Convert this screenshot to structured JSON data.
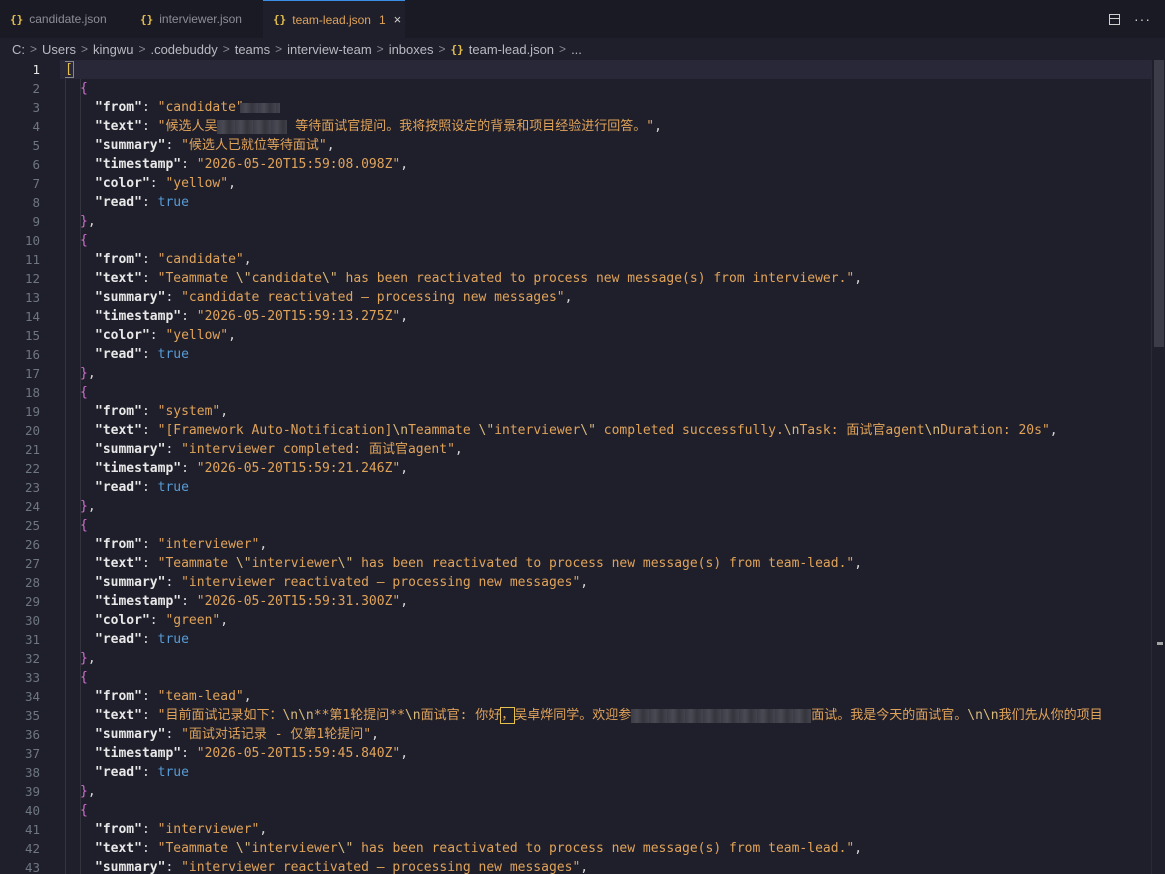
{
  "tabs": [
    {
      "label": "candidate.json",
      "icon": "json-braces-icon",
      "active": false
    },
    {
      "label": "interviewer.json",
      "icon": "json-braces-icon",
      "active": false
    },
    {
      "label": "team-lead.json",
      "icon": "json-braces-icon",
      "active": true,
      "problems_count": "1"
    }
  ],
  "tab_icon_glyph": "{}",
  "tab_close_glyph": "×",
  "actions": {
    "split_editor_icon": "split-editor-icon",
    "more_icon": "more-actions-icon",
    "more_glyph": "···"
  },
  "breadcrumb": [
    "C:",
    "Users",
    "kingwu",
    ".codebuddy",
    "teams",
    "interview-team",
    "inboxes",
    "team-lead.json",
    "..."
  ],
  "breadcrumb_separator": ">",
  "editor": {
    "active_line": 1,
    "line_numbers": [
      "1",
      "2",
      "3",
      "4",
      "5",
      "6",
      "7",
      "8",
      "9",
      "10",
      "11",
      "12",
      "13",
      "14",
      "15",
      "16",
      "17",
      "18",
      "19",
      "20",
      "21",
      "22",
      "23",
      "24",
      "25",
      "26",
      "27",
      "28",
      "29",
      "30",
      "31",
      "32",
      "33",
      "34",
      "35",
      "36",
      "37",
      "38",
      "39",
      "40",
      "41",
      "42",
      "43"
    ],
    "colors": {
      "background": "#1f1f2b",
      "key": "#e8e8e8",
      "string": "#e0a35a",
      "boolean": "#569cd6",
      "bracket_outer": "#e5c04d",
      "bracket_inner": "#d070d0"
    },
    "code_lines": [
      {
        "indent": 0,
        "tokens": [
          {
            "t": "b0",
            "v": "["
          }
        ],
        "bracket_box": true
      },
      {
        "indent": 1,
        "tokens": [
          {
            "t": "b1",
            "v": "{"
          }
        ]
      },
      {
        "indent": 2,
        "tokens": [
          {
            "t": "k",
            "v": "\"from\""
          },
          {
            "t": "p",
            "v": ": "
          },
          {
            "t": "s",
            "v": "\"candidate\""
          }
        ],
        "redact_after": 40
      },
      {
        "indent": 2,
        "tokens": [
          {
            "t": "k",
            "v": "\"text\""
          },
          {
            "t": "p",
            "v": ": "
          },
          {
            "t": "s",
            "v": "\"候选人吴"
          },
          {
            "t": "redact",
            "w": 70
          },
          {
            "t": "s",
            "v": " 等待面试官提问。我将按照设定的背景和项目经验进行回答。\""
          },
          {
            "t": "p",
            "v": ","
          }
        ]
      },
      {
        "indent": 2,
        "tokens": [
          {
            "t": "k",
            "v": "\"summary\""
          },
          {
            "t": "p",
            "v": ": "
          },
          {
            "t": "s",
            "v": "\"候选人已就位等待面试\""
          },
          {
            "t": "p",
            "v": ","
          }
        ]
      },
      {
        "indent": 2,
        "tokens": [
          {
            "t": "k",
            "v": "\"timestamp\""
          },
          {
            "t": "p",
            "v": ": "
          },
          {
            "t": "s",
            "v": "\"2026-05-20T15:59:08.098Z\""
          },
          {
            "t": "p",
            "v": ","
          }
        ]
      },
      {
        "indent": 2,
        "tokens": [
          {
            "t": "k",
            "v": "\"color\""
          },
          {
            "t": "p",
            "v": ": "
          },
          {
            "t": "s",
            "v": "\"yellow\""
          },
          {
            "t": "p",
            "v": ","
          }
        ]
      },
      {
        "indent": 2,
        "tokens": [
          {
            "t": "k",
            "v": "\"read\""
          },
          {
            "t": "p",
            "v": ": "
          },
          {
            "t": "bool",
            "v": "true"
          }
        ]
      },
      {
        "indent": 1,
        "tokens": [
          {
            "t": "b1",
            "v": "}"
          },
          {
            "t": "p",
            "v": ","
          }
        ]
      },
      {
        "indent": 1,
        "tokens": [
          {
            "t": "b1",
            "v": "{"
          }
        ]
      },
      {
        "indent": 2,
        "tokens": [
          {
            "t": "k",
            "v": "\"from\""
          },
          {
            "t": "p",
            "v": ": "
          },
          {
            "t": "s",
            "v": "\"candidate\""
          },
          {
            "t": "p",
            "v": ","
          }
        ]
      },
      {
        "indent": 2,
        "tokens": [
          {
            "t": "k",
            "v": "\"text\""
          },
          {
            "t": "p",
            "v": ": "
          },
          {
            "t": "s",
            "v": "\"Teammate "
          },
          {
            "t": "e",
            "v": "\\\""
          },
          {
            "t": "s",
            "v": "candidate"
          },
          {
            "t": "e",
            "v": "\\\""
          },
          {
            "t": "s",
            "v": " has been reactivated to process new message(s) from interviewer.\""
          },
          {
            "t": "p",
            "v": ","
          }
        ]
      },
      {
        "indent": 2,
        "tokens": [
          {
            "t": "k",
            "v": "\"summary\""
          },
          {
            "t": "p",
            "v": ": "
          },
          {
            "t": "s",
            "v": "\"candidate reactivated — processing new messages\""
          },
          {
            "t": "p",
            "v": ","
          }
        ]
      },
      {
        "indent": 2,
        "tokens": [
          {
            "t": "k",
            "v": "\"timestamp\""
          },
          {
            "t": "p",
            "v": ": "
          },
          {
            "t": "s",
            "v": "\"2026-05-20T15:59:13.275Z\""
          },
          {
            "t": "p",
            "v": ","
          }
        ]
      },
      {
        "indent": 2,
        "tokens": [
          {
            "t": "k",
            "v": "\"color\""
          },
          {
            "t": "p",
            "v": ": "
          },
          {
            "t": "s",
            "v": "\"yellow\""
          },
          {
            "t": "p",
            "v": ","
          }
        ]
      },
      {
        "indent": 2,
        "tokens": [
          {
            "t": "k",
            "v": "\"read\""
          },
          {
            "t": "p",
            "v": ": "
          },
          {
            "t": "bool",
            "v": "true"
          }
        ]
      },
      {
        "indent": 1,
        "tokens": [
          {
            "t": "b1",
            "v": "}"
          },
          {
            "t": "p",
            "v": ","
          }
        ]
      },
      {
        "indent": 1,
        "tokens": [
          {
            "t": "b1",
            "v": "{"
          }
        ]
      },
      {
        "indent": 2,
        "tokens": [
          {
            "t": "k",
            "v": "\"from\""
          },
          {
            "t": "p",
            "v": ": "
          },
          {
            "t": "s",
            "v": "\"system\""
          },
          {
            "t": "p",
            "v": ","
          }
        ]
      },
      {
        "indent": 2,
        "tokens": [
          {
            "t": "k",
            "v": "\"text\""
          },
          {
            "t": "p",
            "v": ": "
          },
          {
            "t": "s",
            "v": "\"[Framework Auto-Notification]"
          },
          {
            "t": "e",
            "v": "\\n"
          },
          {
            "t": "s",
            "v": "Teammate "
          },
          {
            "t": "e",
            "v": "\\\""
          },
          {
            "t": "s",
            "v": "interviewer"
          },
          {
            "t": "e",
            "v": "\\\""
          },
          {
            "t": "s",
            "v": " completed successfully."
          },
          {
            "t": "e",
            "v": "\\n"
          },
          {
            "t": "s",
            "v": "Task: 面试官agent"
          },
          {
            "t": "e",
            "v": "\\n"
          },
          {
            "t": "s",
            "v": "Duration: 20s\""
          },
          {
            "t": "p",
            "v": ","
          }
        ]
      },
      {
        "indent": 2,
        "tokens": [
          {
            "t": "k",
            "v": "\"summary\""
          },
          {
            "t": "p",
            "v": ": "
          },
          {
            "t": "s",
            "v": "\"interviewer completed: 面试官agent\""
          },
          {
            "t": "p",
            "v": ","
          }
        ]
      },
      {
        "indent": 2,
        "tokens": [
          {
            "t": "k",
            "v": "\"timestamp\""
          },
          {
            "t": "p",
            "v": ": "
          },
          {
            "t": "s",
            "v": "\"2026-05-20T15:59:21.246Z\""
          },
          {
            "t": "p",
            "v": ","
          }
        ]
      },
      {
        "indent": 2,
        "tokens": [
          {
            "t": "k",
            "v": "\"read\""
          },
          {
            "t": "p",
            "v": ": "
          },
          {
            "t": "bool",
            "v": "true"
          }
        ]
      },
      {
        "indent": 1,
        "tokens": [
          {
            "t": "b1",
            "v": "}"
          },
          {
            "t": "p",
            "v": ","
          }
        ]
      },
      {
        "indent": 1,
        "tokens": [
          {
            "t": "b1",
            "v": "{"
          }
        ]
      },
      {
        "indent": 2,
        "tokens": [
          {
            "t": "k",
            "v": "\"from\""
          },
          {
            "t": "p",
            "v": ": "
          },
          {
            "t": "s",
            "v": "\"interviewer\""
          },
          {
            "t": "p",
            "v": ","
          }
        ]
      },
      {
        "indent": 2,
        "tokens": [
          {
            "t": "k",
            "v": "\"text\""
          },
          {
            "t": "p",
            "v": ": "
          },
          {
            "t": "s",
            "v": "\"Teammate "
          },
          {
            "t": "e",
            "v": "\\\""
          },
          {
            "t": "s",
            "v": "interviewer"
          },
          {
            "t": "e",
            "v": "\\\""
          },
          {
            "t": "s",
            "v": " has been reactivated to process new message(s) from team-lead.\""
          },
          {
            "t": "p",
            "v": ","
          }
        ]
      },
      {
        "indent": 2,
        "tokens": [
          {
            "t": "k",
            "v": "\"summary\""
          },
          {
            "t": "p",
            "v": ": "
          },
          {
            "t": "s",
            "v": "\"interviewer reactivated — processing new messages\""
          },
          {
            "t": "p",
            "v": ","
          }
        ]
      },
      {
        "indent": 2,
        "tokens": [
          {
            "t": "k",
            "v": "\"timestamp\""
          },
          {
            "t": "p",
            "v": ": "
          },
          {
            "t": "s",
            "v": "\"2026-05-20T15:59:31.300Z\""
          },
          {
            "t": "p",
            "v": ","
          }
        ]
      },
      {
        "indent": 2,
        "tokens": [
          {
            "t": "k",
            "v": "\"color\""
          },
          {
            "t": "p",
            "v": ": "
          },
          {
            "t": "s",
            "v": "\"green\""
          },
          {
            "t": "p",
            "v": ","
          }
        ]
      },
      {
        "indent": 2,
        "tokens": [
          {
            "t": "k",
            "v": "\"read\""
          },
          {
            "t": "p",
            "v": ": "
          },
          {
            "t": "bool",
            "v": "true"
          }
        ]
      },
      {
        "indent": 1,
        "tokens": [
          {
            "t": "b1",
            "v": "}"
          },
          {
            "t": "p",
            "v": ","
          }
        ]
      },
      {
        "indent": 1,
        "tokens": [
          {
            "t": "b1",
            "v": "{"
          }
        ]
      },
      {
        "indent": 2,
        "tokens": [
          {
            "t": "k",
            "v": "\"from\""
          },
          {
            "t": "p",
            "v": ": "
          },
          {
            "t": "s",
            "v": "\"team-lead\""
          },
          {
            "t": "p",
            "v": ","
          }
        ]
      },
      {
        "indent": 2,
        "tokens": [
          {
            "t": "k",
            "v": "\"text\""
          },
          {
            "t": "p",
            "v": ": "
          },
          {
            "t": "s",
            "v": "\"目前面试记录如下："
          },
          {
            "t": "e",
            "v": "\\n\\n"
          },
          {
            "t": "s",
            "v": "**第1轮提问**"
          },
          {
            "t": "e",
            "v": "\\n"
          },
          {
            "t": "s",
            "v": "面试官: 你好"
          },
          {
            "t": "cursor",
            "v": "，"
          },
          {
            "t": "s",
            "v": "吴卓烨同学。欢迎参"
          },
          {
            "t": "redact",
            "w": 180
          },
          {
            "t": "s",
            "v": "面试。我是今天的面试官。"
          },
          {
            "t": "e",
            "v": "\\n\\n"
          },
          {
            "t": "s",
            "v": "我们先从你的项目"
          }
        ]
      },
      {
        "indent": 2,
        "tokens": [
          {
            "t": "k",
            "v": "\"summary\""
          },
          {
            "t": "p",
            "v": ": "
          },
          {
            "t": "s",
            "v": "\"面试对话记录 - 仅第1轮提问\""
          },
          {
            "t": "p",
            "v": ","
          }
        ]
      },
      {
        "indent": 2,
        "tokens": [
          {
            "t": "k",
            "v": "\"timestamp\""
          },
          {
            "t": "p",
            "v": ": "
          },
          {
            "t": "s",
            "v": "\"2026-05-20T15:59:45.840Z\""
          },
          {
            "t": "p",
            "v": ","
          }
        ]
      },
      {
        "indent": 2,
        "tokens": [
          {
            "t": "k",
            "v": "\"read\""
          },
          {
            "t": "p",
            "v": ": "
          },
          {
            "t": "bool",
            "v": "true"
          }
        ]
      },
      {
        "indent": 1,
        "tokens": [
          {
            "t": "b1",
            "v": "}"
          },
          {
            "t": "p",
            "v": ","
          }
        ]
      },
      {
        "indent": 1,
        "tokens": [
          {
            "t": "b1",
            "v": "{"
          }
        ]
      },
      {
        "indent": 2,
        "tokens": [
          {
            "t": "k",
            "v": "\"from\""
          },
          {
            "t": "p",
            "v": ": "
          },
          {
            "t": "s",
            "v": "\"interviewer\""
          },
          {
            "t": "p",
            "v": ","
          }
        ]
      },
      {
        "indent": 2,
        "tokens": [
          {
            "t": "k",
            "v": "\"text\""
          },
          {
            "t": "p",
            "v": ": "
          },
          {
            "t": "s",
            "v": "\"Teammate "
          },
          {
            "t": "e",
            "v": "\\\""
          },
          {
            "t": "s",
            "v": "interviewer"
          },
          {
            "t": "e",
            "v": "\\\""
          },
          {
            "t": "s",
            "v": " has been reactivated to process new message(s) from team-lead.\""
          },
          {
            "t": "p",
            "v": ","
          }
        ]
      },
      {
        "indent": 2,
        "tokens": [
          {
            "t": "k",
            "v": "\"summary\""
          },
          {
            "t": "p",
            "v": ": "
          },
          {
            "t": "s",
            "v": "\"interviewer reactivated — processing new messages\""
          },
          {
            "t": "p",
            "v": ","
          }
        ]
      }
    ]
  }
}
